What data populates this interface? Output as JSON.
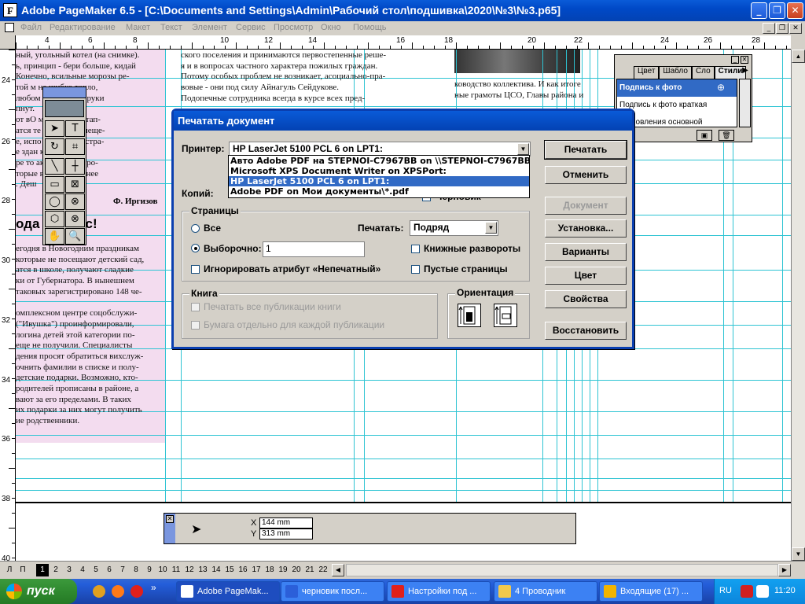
{
  "window": {
    "title": "Adobe PageMaker 6.5 - [C:\\Documents and Settings\\Admin\\Рабочий стол\\подшивка\\2020\\№3\\№3.p65]",
    "app_icon_glyph": "F"
  },
  "menu": [
    "Файл",
    "Редактирование",
    "Макет",
    "Текст",
    "Элемент",
    "Сервис",
    "Просмотр",
    "Окно",
    "Помощь"
  ],
  "ruler": {
    "h": [
      "4",
      "6",
      "8",
      "10",
      "12",
      "14",
      "16",
      "18",
      "20",
      "22",
      "24",
      "26",
      "28"
    ],
    "v": [
      "24",
      "26",
      "28",
      "30",
      "32",
      "34",
      "36",
      "38",
      "40"
    ]
  },
  "document": {
    "col1": [
      "ный, угольный котел (на снимке).",
      "ь, принцип - бери больше, кидай",
      "Конечно, всильные морозы ре-",
      "той м                   не шибко тепло,",
      "любом             ти ремонт - руки",
      "пнут.",
      "от вО             мастерская отап-",
      "атся те           торами, помеще-",
      "е, испо          как администра-",
      "е здан           котлом, а в",
      "ре то              акновенные дро-",
      "торые            ваются в летнее",
      ". Деш"
    ],
    "signature": "Ф. Иргизов",
    "headline": "ода             дут вас!",
    "col1b": [
      "егодня в Новогодним праздникам",
      "которые не посещают детский сад,",
      "атся в школе, получают сладкие",
      "ки от Губернатора. В нынешнем",
      "таковых зарегистрировано 148 че-",
      "",
      "омплексном центре соцобслужи-",
      "(\"Ивушка\") проинформировали,",
      "логина детей этой категории по-",
      "еще не получили. Специалисты",
      "дения просят обратиться вихслуж-",
      "очнить фамилии в списке и полу-",
      "детские подарки. Возможно, кто-",
      "родителей прописаны в районе, а",
      "вают за его пределами. В таких",
      "их подарки за них могут получить",
      "ие родственники."
    ],
    "col2": [
      "ского поселения и принимаются первостепенные реше-",
      "я и в вопросах частного характера пожилых граждан.",
      "Потому особых проблем не возникает, асоциально-пра-",
      "вовые - они под силу Айнагуль Сейдукове.",
      "      Подопечные сотрудника всегда в курсе всех пред-"
    ],
    "col3": [
      "ководство коллектива. И как итоге",
      "ные грамоты ЦСО, Главы района и"
    ]
  },
  "styles_palette": {
    "tabs": [
      "Цвет",
      "Шабло",
      "Сло",
      "Стили"
    ],
    "items": [
      "Подпись к фото",
      "Подпись к фото  краткая",
      "становления  основной"
    ]
  },
  "dialog": {
    "title": "Печатать документ",
    "printer_label": "Принтер:",
    "printer_value": "HP LaserJet 5100 PCL 6 on LPT1:",
    "printer_options": [
      "Авто Adobe PDF на STEPNOI-C7967BB on \\\\STEPNOI-C7967BB\\",
      "Microsoft XPS Document Writer on XPSPort:",
      "HP LaserJet 5100 PCL 6 on LPT1:",
      "Adobe PDF on Мои документы\\*.pdf"
    ],
    "copies_label": "Копий:",
    "draft_label": "Черновик",
    "pages_group": "Страницы",
    "all_label": "Все",
    "selected_label": "Выборочно:",
    "range_value": "1",
    "print_label": "Печатать:",
    "print_value": "Подряд",
    "spreads_label": "Книжные развороты",
    "ignore_label": "Игнорировать атрибут «Непечатный»",
    "blank_label": "Пустые страницы",
    "book_group": "Книга",
    "book_all_label": "Печатать все публикации книги",
    "book_paper_label": "Бумага отдельно для каждой публикации",
    "orient_group": "Ориентация",
    "buttons": {
      "print": "Печатать",
      "cancel": "Отменить",
      "document": "Документ",
      "setup": "Установка...",
      "options": "Варианты",
      "color": "Цвет",
      "properties": "Свойства",
      "restore": "Восстановить"
    }
  },
  "control_palette": {
    "x_label": "X",
    "x_value": "144 mm",
    "y_label": "Y",
    "y_value": "313 mm"
  },
  "pages": {
    "left": "Л",
    "right": "П",
    "current": "1",
    "list": [
      "2",
      "3",
      "4",
      "5",
      "6",
      "7",
      "8",
      "9",
      "10",
      "11",
      "12",
      "13",
      "14",
      "15",
      "16",
      "17",
      "18",
      "19",
      "20",
      "21",
      "22"
    ]
  },
  "taskbar": {
    "start": "пуск",
    "items": [
      {
        "label": "Adobe PageMak...",
        "icon": "pagemaker-icon",
        "color": "#ffffff"
      },
      {
        "label": "черновик посл...",
        "icon": "word-icon",
        "color": "#2b5fd9"
      },
      {
        "label": "Настройки под ...",
        "icon": "opera-icon",
        "color": "#e0201b"
      },
      {
        "label": "4 Проводник",
        "icon": "folder-icon",
        "color": "#f2c94c"
      },
      {
        "label": "Входящие (17) ...",
        "icon": "chrome-icon",
        "color": "#f2b400"
      }
    ],
    "lang": "RU",
    "clock": "11:20"
  }
}
